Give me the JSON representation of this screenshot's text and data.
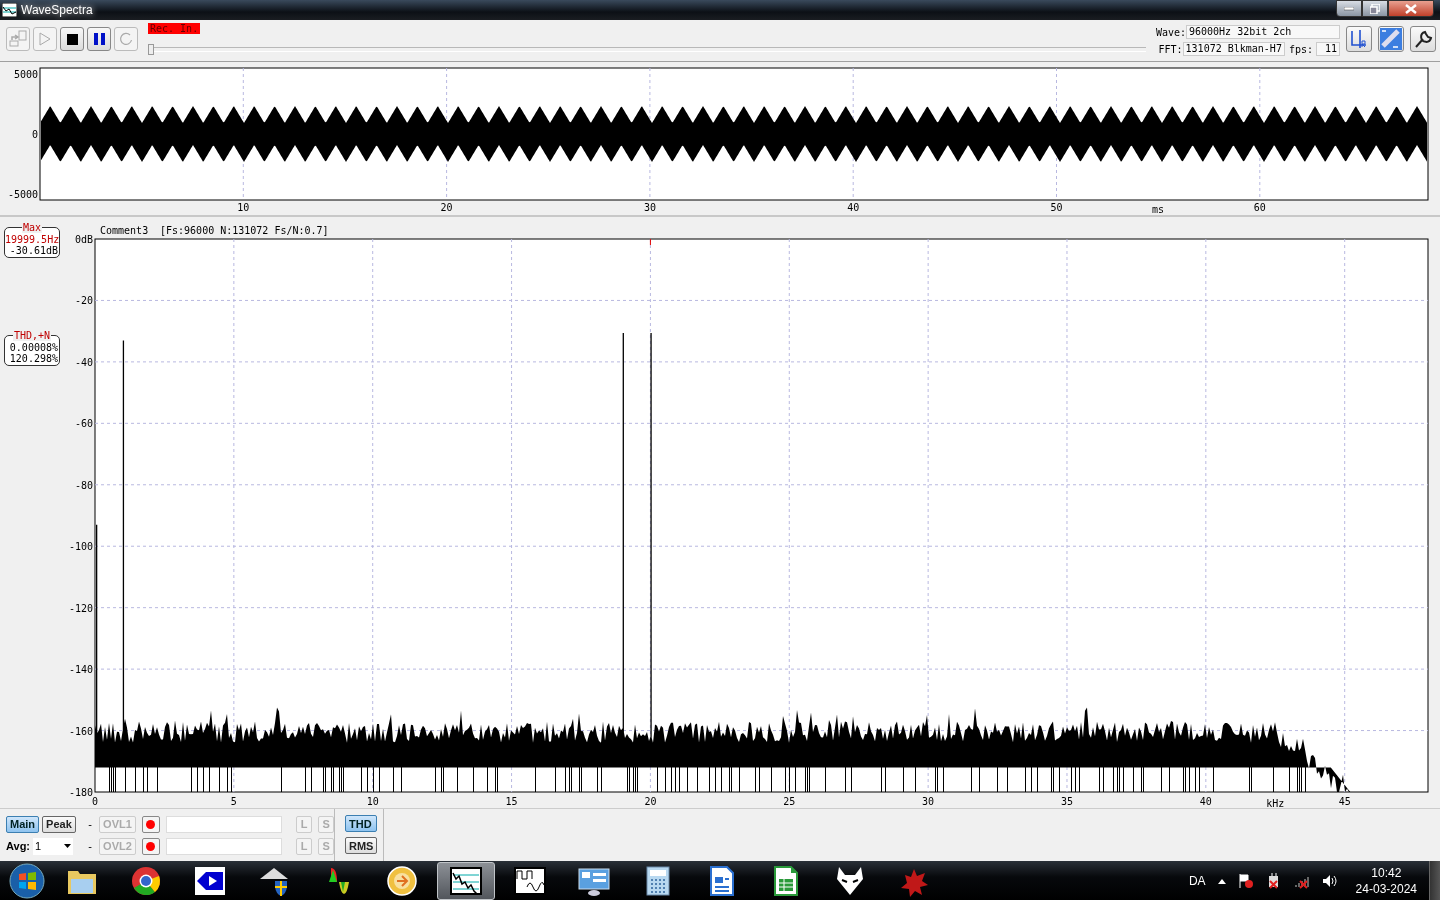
{
  "window": {
    "title": "WaveSpectra"
  },
  "toolbar": {
    "buttons": [
      {
        "kind": "export",
        "disabled": true
      },
      {
        "kind": "play",
        "disabled": true
      },
      {
        "kind": "stop",
        "disabled": false
      },
      {
        "kind": "pause",
        "disabled": false
      },
      {
        "kind": "loop",
        "disabled": true
      }
    ],
    "rec_label": "Rec. In.",
    "position": {
      "level": 0
    },
    "wave_label": "Wave:",
    "wave_value": "96000Hz 32bit 2ch",
    "fft_label": "FFT:",
    "fft_value": "131072 Blkman-H7",
    "fps_label": "fps:",
    "fps_value": "11",
    "tools": [
      {
        "kind": "channels"
      },
      {
        "kind": "scale"
      },
      {
        "kind": "settings"
      }
    ]
  },
  "wave_view": {
    "y_ticks": [
      "5000",
      "0",
      "-5000"
    ],
    "x_ticks": [
      "10",
      "20",
      "30",
      "40",
      "50",
      "60"
    ],
    "x_unit": "ms"
  },
  "spectrum_view": {
    "comment": "Comment3",
    "params": "[Fs:96000 N:131072 Fs/N:0.7]",
    "y_ticks": [
      "0dB",
      "-20",
      "-40",
      "-60",
      "-80",
      "-100",
      "-120",
      "-140",
      "-160",
      "-180"
    ],
    "x_ticks": [
      "0",
      "5",
      "10",
      "15",
      "20",
      "25",
      "30",
      "35",
      "40",
      "45"
    ],
    "x_unit": "kHz",
    "max_box": {
      "title": "Max",
      "frequency": "19999.5Hz",
      "level": "-30.61dB"
    },
    "thd_box": {
      "title": "THD,+N",
      "thd": "0.00008%",
      "thdn": "120.298%"
    }
  },
  "controls": {
    "main": {
      "label": "Main",
      "selected": true
    },
    "peak": {
      "label": "Peak",
      "selected": false
    },
    "avg_label": "Avg:",
    "avg_value": "1",
    "rows": [
      {
        "dash": "-",
        "ovl": "OVL1",
        "l": "L",
        "s": "S"
      },
      {
        "dash": "-",
        "ovl": "OVL2",
        "l": "L",
        "s": "S"
      }
    ],
    "thd": {
      "label": "THD",
      "selected": true
    },
    "rms": {
      "label": "RMS",
      "selected": false
    }
  },
  "taskbar": {
    "apps": [
      {
        "kind": "folder",
        "selected": false
      },
      {
        "kind": "browser",
        "selected": false
      },
      {
        "kind": "player",
        "selected": false
      },
      {
        "kind": "shield",
        "selected": false
      },
      {
        "kind": "colors",
        "selected": false
      },
      {
        "kind": "disc",
        "selected": false
      },
      {
        "kind": "spectrum",
        "selected": true
      },
      {
        "kind": "scope",
        "selected": false
      },
      {
        "kind": "panel",
        "selected": false
      },
      {
        "kind": "calculator",
        "selected": false
      },
      {
        "kind": "document",
        "selected": false
      },
      {
        "kind": "spreadsheet",
        "selected": false
      },
      {
        "kind": "fox",
        "selected": false
      },
      {
        "kind": "splat",
        "selected": false
      }
    ],
    "language": "DA",
    "time": "10:42",
    "date": "24-03-2024"
  }
}
